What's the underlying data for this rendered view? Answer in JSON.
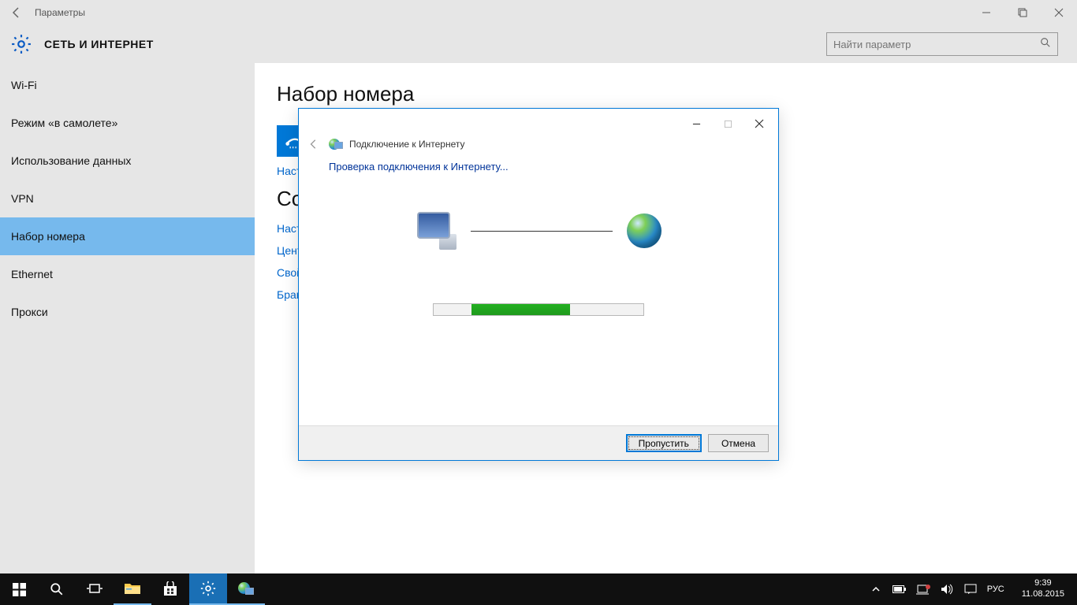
{
  "window": {
    "app_title": "Параметры",
    "section_title": "СЕТЬ И ИНТЕРНЕТ",
    "search_placeholder": "Найти параметр"
  },
  "sidebar": {
    "items": [
      {
        "label": "Wi-Fi"
      },
      {
        "label": "Режим «в самолете»"
      },
      {
        "label": "Использование данных"
      },
      {
        "label": "VPN"
      },
      {
        "label": "Набор номера"
      },
      {
        "label": "Ethernet"
      },
      {
        "label": "Прокси"
      }
    ],
    "active_index": 4
  },
  "content": {
    "heading": "Набор номера",
    "setup_link_partial": "Настр",
    "section2_partial": "Со",
    "links_partial": [
      "Настр",
      "Цент",
      "Свой",
      "Бран"
    ]
  },
  "dialog": {
    "title": "Подключение к Интернету",
    "message": "Проверка подключения к Интернету...",
    "skip_label": "Пропустить",
    "cancel_label": "Отмена"
  },
  "taskbar": {
    "lang": "РУС",
    "time": "9:39",
    "date": "11.08.2015"
  }
}
